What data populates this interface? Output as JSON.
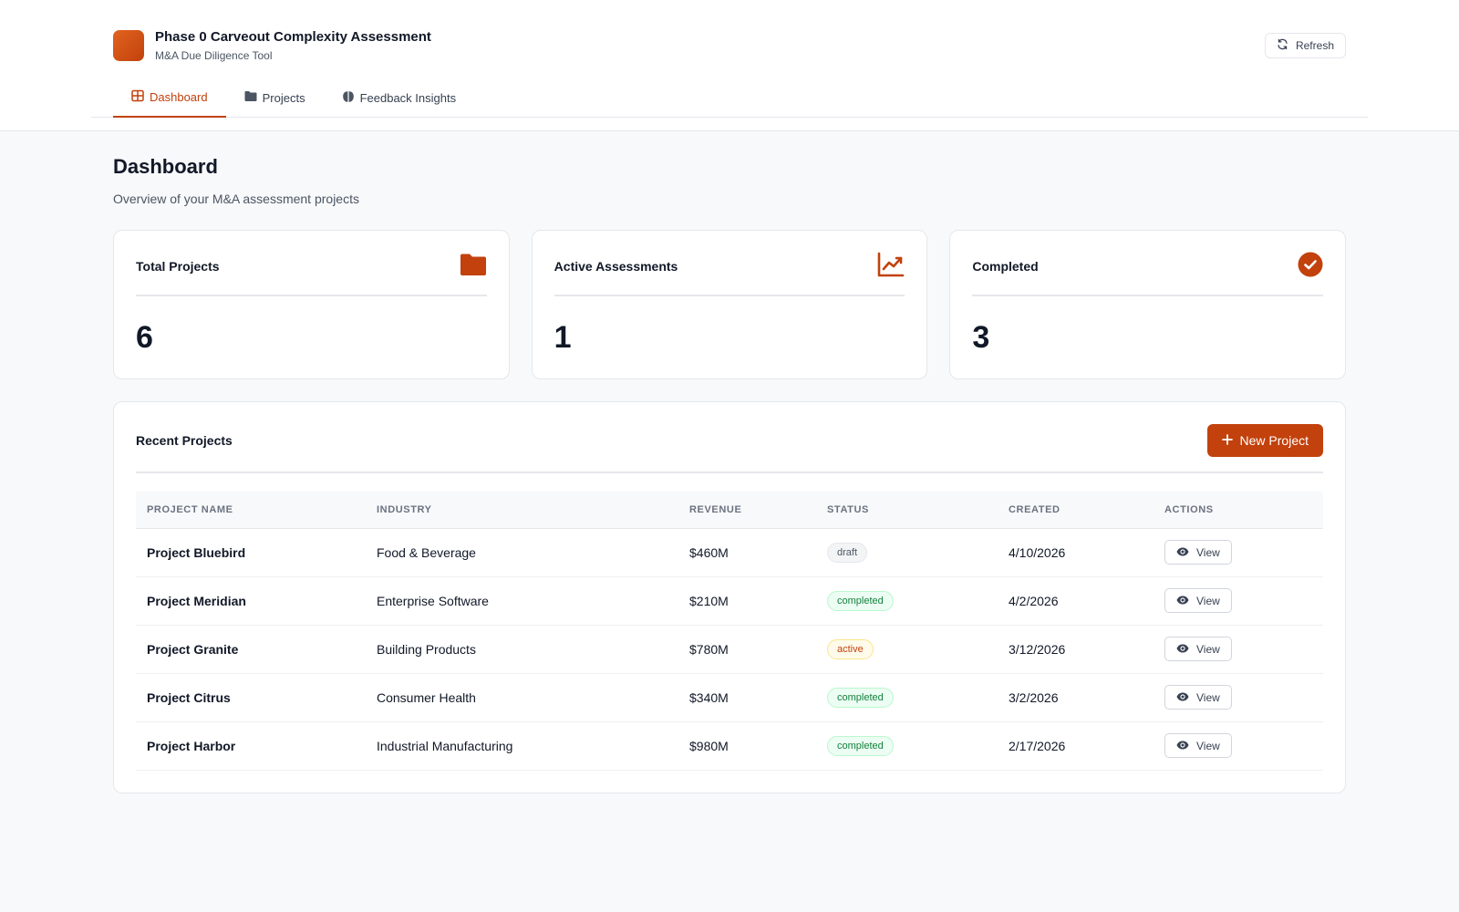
{
  "app": {
    "title": "Phase 0 Carveout Complexity Assessment",
    "subtitle": "M&A Due Diligence Tool",
    "refresh_label": "Refresh"
  },
  "nav": {
    "tabs": [
      {
        "label": "Dashboard",
        "icon": "grid-icon",
        "active": true
      },
      {
        "label": "Projects",
        "icon": "folder-icon",
        "active": false
      },
      {
        "label": "Feedback Insights",
        "icon": "brain-icon",
        "active": false
      }
    ]
  },
  "page": {
    "title": "Dashboard",
    "subtitle": "Overview of your M&A assessment projects"
  },
  "stats": [
    {
      "label": "Total Projects",
      "value": "6",
      "icon": "folder-icon"
    },
    {
      "label": "Active Assessments",
      "value": "1",
      "icon": "chart-line-icon"
    },
    {
      "label": "Completed",
      "value": "3",
      "icon": "check-circle-icon"
    }
  ],
  "recent": {
    "title": "Recent Projects",
    "new_button_label": "New Project",
    "columns": [
      "PROJECT NAME",
      "INDUSTRY",
      "REVENUE",
      "STATUS",
      "CREATED",
      "ACTIONS"
    ],
    "rows": [
      {
        "name": "Project Bluebird",
        "industry": "Food & Beverage",
        "revenue": "$460M",
        "status": "draft",
        "created": "4/10/2026",
        "action": "View"
      },
      {
        "name": "Project Meridian",
        "industry": "Enterprise Software",
        "revenue": "$210M",
        "status": "completed",
        "created": "4/2/2026",
        "action": "View"
      },
      {
        "name": "Project Granite",
        "industry": "Building Products",
        "revenue": "$780M",
        "status": "active",
        "created": "3/12/2026",
        "action": "View"
      },
      {
        "name": "Project Citrus",
        "industry": "Consumer Health",
        "revenue": "$340M",
        "status": "completed",
        "created": "3/2/2026",
        "action": "View"
      },
      {
        "name": "Project Harbor",
        "industry": "Industrial Manufacturing",
        "revenue": "$980M",
        "status": "completed",
        "created": "2/17/2026",
        "action": "View"
      }
    ]
  },
  "colors": {
    "accent": "#c2410c",
    "background": "#f8f9fb"
  }
}
